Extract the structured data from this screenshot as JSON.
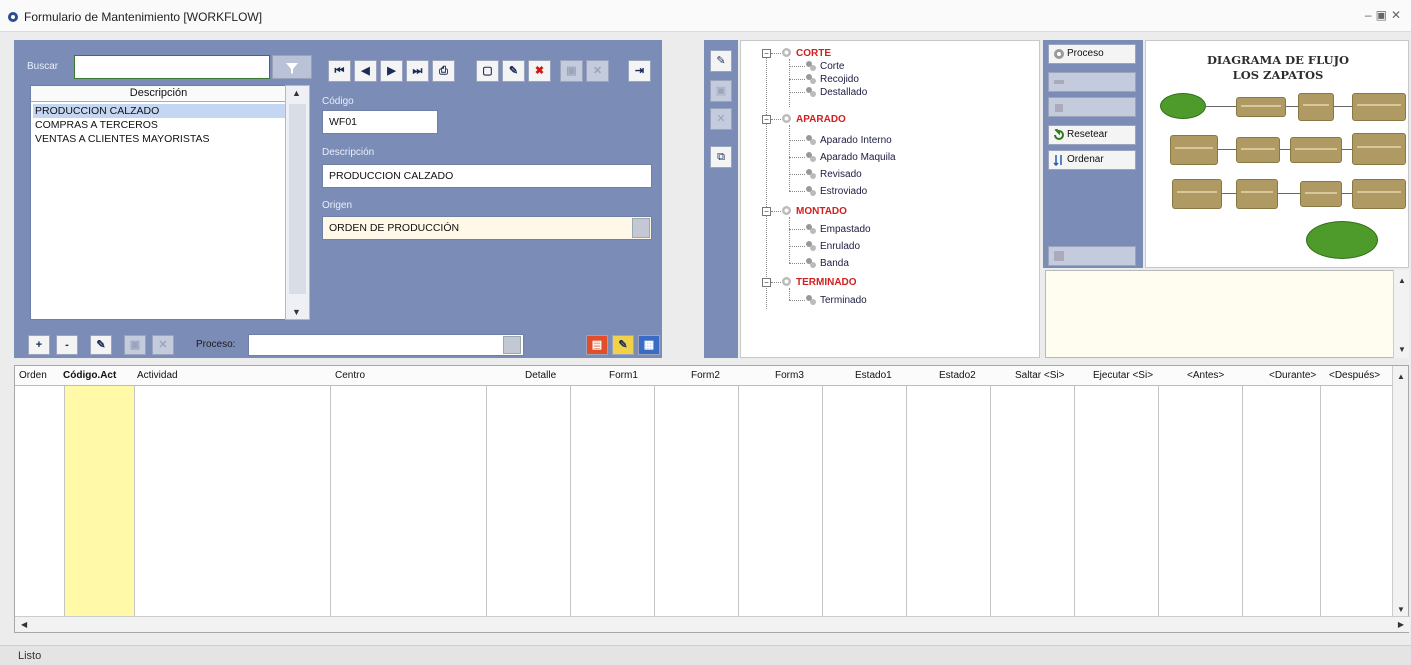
{
  "window": {
    "title": "Formulario de Mantenimiento [WORKFLOW]",
    "controls": [
      "–",
      "▣",
      "✕"
    ]
  },
  "search": {
    "label": "Buscar",
    "value": "",
    "filter_icon": "filter-icon"
  },
  "list": {
    "header": "Descripción",
    "items": [
      "PRODUCCION CALZADO",
      "COMPRAS A TERCEROS",
      "VENTAS A CLIENTES MAYORISTAS"
    ],
    "selected_index": 0
  },
  "nav_toolbar": {
    "icons": [
      "first-record-icon",
      "prev-record-icon",
      "next-record-icon",
      "last-record-icon",
      "print-icon",
      "new-icon",
      "edit-icon",
      "delete-icon",
      "save-icon",
      "cancel-icon",
      "exit-icon"
    ]
  },
  "form": {
    "codigo_label": "Código",
    "codigo_value": "WF01",
    "descripcion_label": "Descripción",
    "descripcion_value": "PRODUCCION CALZADO",
    "origen_label": "Origen",
    "origen_value": "ORDEN DE PRODUCCIÓN"
  },
  "bottom_toolbar": {
    "add": "+",
    "remove": "-",
    "proceso_label": "Proceso:",
    "proceso_value": ""
  },
  "tree": {
    "nodes": [
      {
        "label": "CORTE",
        "children": [
          "Corte",
          "Recojido",
          "Destallado"
        ]
      },
      {
        "label": "APARADO",
        "children": [
          "Aparado Interno",
          "Aparado Maquila",
          "Revisado",
          "Estroviado"
        ]
      },
      {
        "label": "MONTADO",
        "children": [
          "Empastado",
          "Enrulado",
          "Banda"
        ]
      },
      {
        "label": "TERMINADO",
        "children": [
          "Terminado"
        ]
      }
    ]
  },
  "actions": {
    "proceso": "Proceso",
    "resetear": "Resetear",
    "ordenar": "Ordenar"
  },
  "diagram": {
    "title_line1": "DIAGRAMA DE FLUJO",
    "title_line2": "LOS ZAPATOS"
  },
  "grid": {
    "columns": [
      "Orden",
      "Código.Act",
      "Actividad",
      "Centro",
      "Detalle",
      "Form1",
      "Form2",
      "Form3",
      "Estado1",
      "Estado2",
      "Saltar <Si>",
      "Ejecutar <Si>",
      "<Antes>",
      "<Durante>",
      "<Después>"
    ]
  },
  "status": {
    "text": "Listo"
  },
  "colors": {
    "panel_blue": "#7b8db7",
    "highlight_yellow": "#fff9a8",
    "tree_parent_red": "#d22020"
  }
}
